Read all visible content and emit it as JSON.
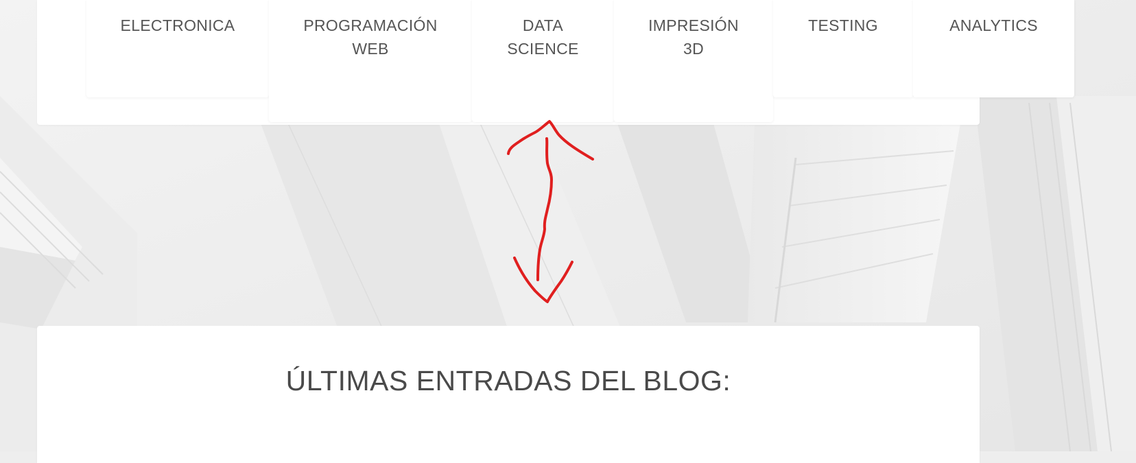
{
  "categories": [
    {
      "label": "ELECTRONICA"
    },
    {
      "label": "PROGRAMACIÓN WEB"
    },
    {
      "label": "DATA SCIENCE"
    },
    {
      "label": "IMPRESIÓN 3D"
    },
    {
      "label": "TESTING"
    },
    {
      "label": "ANALYTICS"
    }
  ],
  "blog": {
    "heading": "ÚLTIMAS ENTRADAS DEL BLOG:"
  },
  "annotation": {
    "type": "double-headed-arrow",
    "color": "#e01f1f"
  },
  "colors": {
    "panel": "#ffffff",
    "text": "#555555",
    "background": "#eeeeee"
  }
}
